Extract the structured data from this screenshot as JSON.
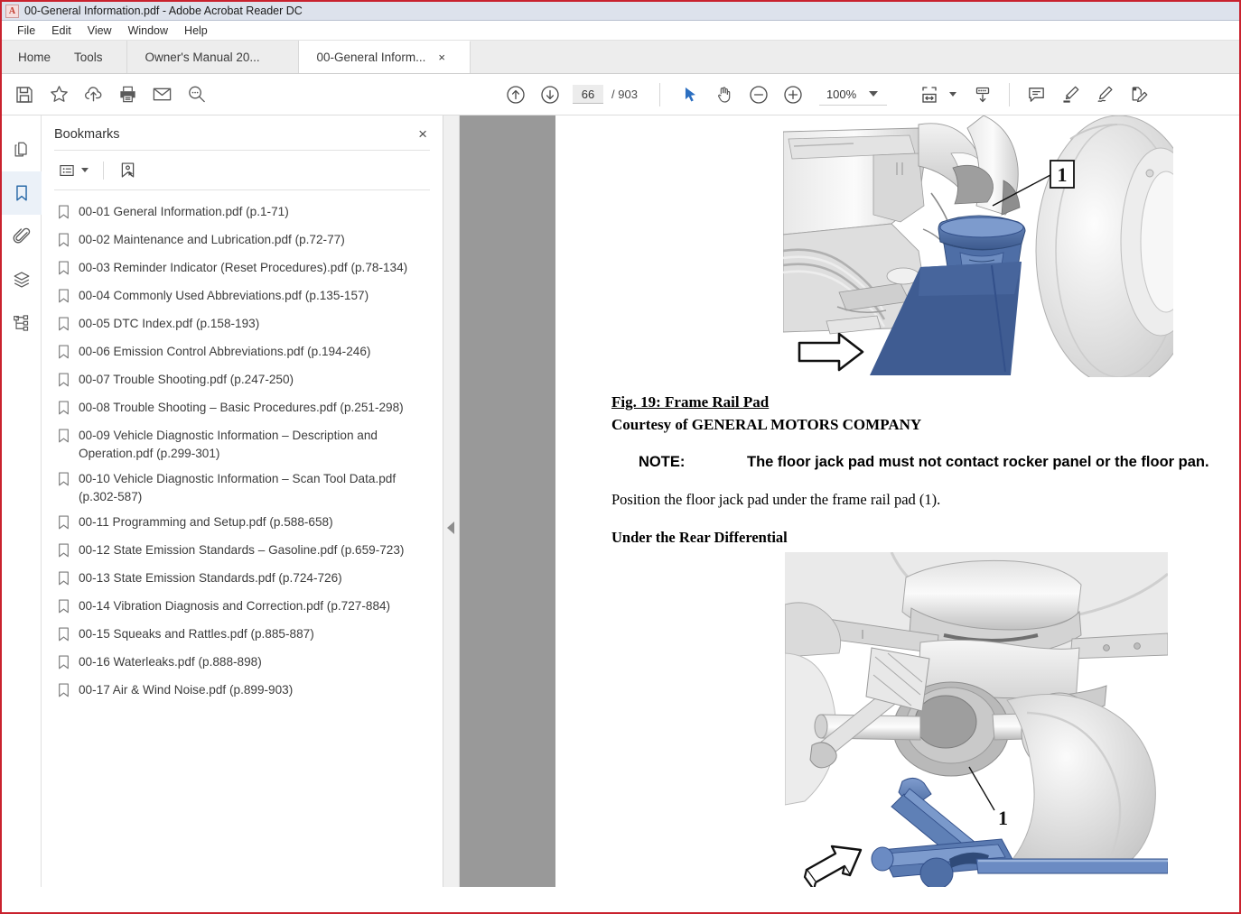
{
  "window": {
    "title": "00-General Information.pdf - Adobe Acrobat Reader DC",
    "app_icon": "acrobat-icon",
    "border_color": "#c9222e",
    "titlebar_color": "#dde2ec"
  },
  "menubar": {
    "items": [
      {
        "label": "File"
      },
      {
        "label": "Edit"
      },
      {
        "label": "View"
      },
      {
        "label": "Window"
      },
      {
        "label": "Help"
      }
    ]
  },
  "tabstrip": {
    "nav_tabs": [
      {
        "label": "Home"
      },
      {
        "label": "Tools"
      }
    ],
    "doc_tabs": [
      {
        "label": "Owner's Manual 20...",
        "active": false,
        "closable": false
      },
      {
        "label": "00-General Inform...",
        "active": true,
        "closable": true,
        "close_glyph": "×"
      }
    ]
  },
  "toolbar": {
    "left_buttons": [
      {
        "name": "save-button",
        "icon": "save-icon",
        "tooltip": "Save File"
      },
      {
        "name": "add-to-favorites-button",
        "icon": "star-icon",
        "tooltip": "Add to Favorites"
      },
      {
        "name": "upload-to-cloud-button",
        "icon": "cloud-upload-icon",
        "tooltip": "Upload"
      },
      {
        "name": "print-button",
        "icon": "printer-icon",
        "tooltip": "Print File"
      },
      {
        "name": "email-button",
        "icon": "envelope-icon",
        "tooltip": "Send File by Email"
      },
      {
        "name": "find-button",
        "icon": "search-magnifier-icon",
        "tooltip": "Find"
      }
    ],
    "page_nav": {
      "previous_icon": "arrow-up-circle-icon",
      "next_icon": "arrow-down-circle-icon",
      "current_page": "66",
      "page_separator": "/",
      "total_pages": "903"
    },
    "view_buttons": [
      {
        "name": "select-tool-button",
        "icon": "cursor-arrow-icon",
        "active": true
      },
      {
        "name": "hand-tool-button",
        "icon": "hand-icon",
        "active": false
      },
      {
        "name": "zoom-out-button",
        "icon": "minus-circle-icon",
        "active": false
      },
      {
        "name": "zoom-in-button",
        "icon": "plus-circle-icon",
        "active": false
      }
    ],
    "zoom_level": "100%",
    "right_buttons": [
      {
        "name": "fit-page-button",
        "icon": "fit-width-icon",
        "has_dropdown": true
      },
      {
        "name": "scroll-mode-button",
        "icon": "page-scroll-icon",
        "has_dropdown": false
      },
      {
        "name": "comment-button",
        "icon": "comment-bubble-icon",
        "has_dropdown": false
      },
      {
        "name": "highlight-button",
        "icon": "highlighter-pen-icon",
        "has_dropdown": false
      },
      {
        "name": "sign-button",
        "icon": "signature-icon",
        "has_dropdown": false
      },
      {
        "name": "edit-pdf-button",
        "icon": "edit-pdf-icon",
        "has_dropdown": false
      }
    ]
  },
  "sidebar_rail": {
    "items": [
      {
        "name": "page-thumbnails-icon",
        "label": "Page Thumbnails",
        "active": false
      },
      {
        "name": "bookmarks-icon",
        "label": "Bookmarks",
        "active": true
      },
      {
        "name": "attachments-icon",
        "label": "Attachments",
        "active": false
      },
      {
        "name": "layers-icon",
        "label": "Layers",
        "active": false
      },
      {
        "name": "tags-icon",
        "label": "Tags",
        "active": false
      }
    ],
    "active_color": "#2a6aa8"
  },
  "bookmarks_panel": {
    "title": "Bookmarks",
    "close_glyph": "×",
    "toolbar": [
      {
        "name": "bookmark-options-button",
        "icon": "list-options-icon",
        "has_dropdown": true
      },
      {
        "name": "new-bookmark-button",
        "icon": "new-bookmark-icon",
        "has_dropdown": false
      }
    ],
    "items": [
      {
        "label": "00-01 General Information.pdf (p.1-71)"
      },
      {
        "label": "00-02 Maintenance and Lubrication.pdf (p.72-77)"
      },
      {
        "label": "00-03 Reminder Indicator (Reset Procedures).pdf (p.78-134)"
      },
      {
        "label": "00-04 Commonly Used Abbreviations.pdf (p.135-157)"
      },
      {
        "label": "00-05 DTC Index.pdf (p.158-193)"
      },
      {
        "label": "00-06 Emission Control Abbreviations.pdf (p.194-246)"
      },
      {
        "label": "00-07 Trouble Shooting.pdf (p.247-250)"
      },
      {
        "label": "00-08 Trouble Shooting – Basic Procedures.pdf (p.251-298)"
      },
      {
        "label": "00-09 Vehicle Diagnostic Information – Description and Operation.pdf (p.299-301)"
      },
      {
        "label": "00-10 Vehicle Diagnostic Information – Scan Tool Data.pdf (p.302-587)"
      },
      {
        "label": "00-11 Programming and Setup.pdf (p.588-658)"
      },
      {
        "label": "00-12 State Emission Standards – Gasoline.pdf (p.659-723)"
      },
      {
        "label": "00-13 State Emission Standards.pdf (p.724-726)"
      },
      {
        "label": "00-14 Vibration Diagnosis and Correction.pdf (p.727-884)"
      },
      {
        "label": "00-15 Squeaks and Rattles.pdf (p.885-887)"
      },
      {
        "label": "00-16 Waterleaks.pdf (p.888-898)"
      },
      {
        "label": "00-17 Air & Wind Noise.pdf (p.899-903)"
      }
    ]
  },
  "splitter": {
    "collapse_icon": "chevron-left-icon"
  },
  "document": {
    "background_color": "#999999",
    "page_color": "#ffffff",
    "figure_1": {
      "name": "frame-rail-pad-illustration",
      "callout": "1",
      "direction_arrow": "right-arrow",
      "accent_color": "#3f5c92"
    },
    "fig_title": "Fig. 19: Frame Rail Pad",
    "fig_courtesy": "Courtesy of GENERAL MOTORS COMPANY",
    "note_label": "NOTE:",
    "note_text": "The floor jack pad must not contact rocker panel or the floor pan.",
    "paragraph": "Position the floor jack pad under the frame rail pad (1).",
    "subheading": "Under the Rear Differential",
    "figure_2": {
      "name": "rear-differential-jack-illustration",
      "callout": "1",
      "direction_arrow": "left-arrow",
      "accent_color": "#5b7cb8"
    }
  }
}
